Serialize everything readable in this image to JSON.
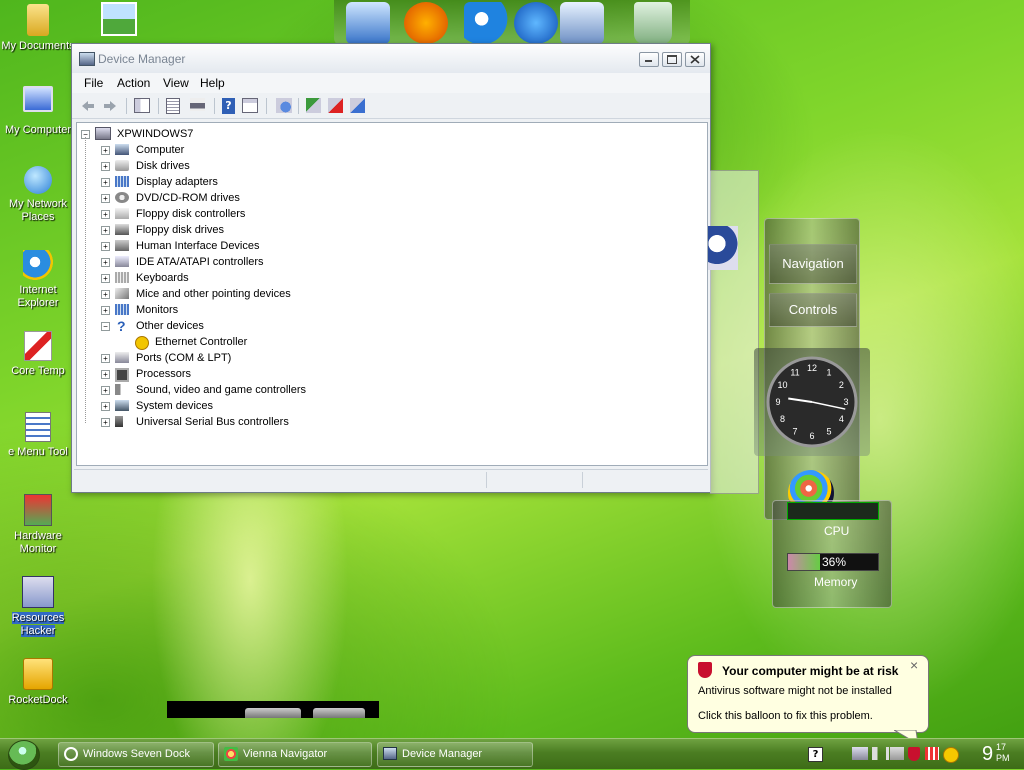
{
  "desktop_icons": [
    {
      "label": "My Documents"
    },
    {
      "label": "My Computer"
    },
    {
      "label": "My Network Places"
    },
    {
      "label": "Internet Explorer"
    },
    {
      "label": "Core Temp"
    },
    {
      "label": "e Menu Tool"
    },
    {
      "label": "Hardware Monitor"
    },
    {
      "label": "Resources Hacker"
    },
    {
      "label": "RocketDock"
    }
  ],
  "window": {
    "title": "Device Manager",
    "menu": [
      "File",
      "Action",
      "View",
      "Help"
    ],
    "tree": {
      "root": "XPWINDOWS7",
      "categories": [
        "Computer",
        "Disk drives",
        "Display adapters",
        "DVD/CD-ROM drives",
        "Floppy disk controllers",
        "Floppy disk drives",
        "Human Interface Devices",
        "IDE ATA/ATAPI controllers",
        "Keyboards",
        "Mice and other pointing devices",
        "Monitors",
        "Other devices",
        "Ports (COM & LPT)",
        "Processors",
        "Sound, video and game controllers",
        "System devices",
        "Universal Serial Bus controllers"
      ],
      "other_devices_child": "Ethernet Controller"
    }
  },
  "gadgets": {
    "navigation_label": "Navigation",
    "controls_label": "Controls",
    "cpu_label": "CPU",
    "memory_label": "Memory",
    "memory_percent_text": "36%",
    "memory_fraction": 0.36,
    "clock_numbers": [
      "12",
      "1",
      "2",
      "3",
      "4",
      "5",
      "6",
      "7",
      "8",
      "9",
      "10",
      "11"
    ]
  },
  "balloon": {
    "title": "Your computer might be at risk",
    "line1": "Antivirus software might not be installed",
    "line2": "Click this balloon to fix this problem.",
    "close": "×"
  },
  "taskbar": {
    "buttons": [
      "Windows Seven Dock",
      "Vienna Navigator",
      "Device Manager"
    ],
    "help_glyph": "?",
    "clock_hour": "9",
    "clock_minute": "17",
    "clock_ampm": "PM"
  },
  "colors": {
    "accent": "#316ac5",
    "warning": "#f2c500",
    "alert_red": "#c8102e"
  }
}
